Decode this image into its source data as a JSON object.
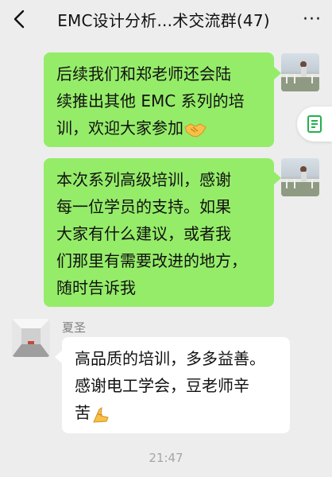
{
  "header": {
    "title": "EMC设计分析...术交流群(47)",
    "back_icon": "chevron-left-icon",
    "more_icon": "more-dots-icon",
    "more_label": "···"
  },
  "colors": {
    "background": "#ededed",
    "my_bubble": "#95ec69",
    "other_bubble": "#ffffff",
    "side_tab_icon": "#23b14d"
  },
  "messages": [
    {
      "sender": "me",
      "lines": [
        "后续我们和郑老师还会陆",
        "续推出其他 EMC 系列的培",
        "训，欢迎大家参加"
      ],
      "trailing_icon": "handshake-emoji"
    },
    {
      "sender": "me",
      "lines": [
        "本次系列高级培训，感谢",
        "每一位学员的支持。如果",
        "大家有什么建议，或者我",
        "们那里有需要改进的地方，",
        "随时告诉我"
      ]
    },
    {
      "sender": "other",
      "sender_name": "夏圣",
      "lines": [
        "高品质的培训，多多益善。",
        "感谢电工学会，豆老师辛",
        "苦"
      ],
      "trailing_icon": "praying-hands-emoji"
    }
  ],
  "timestamp": "21:47",
  "side_tab": {
    "icon": "document-icon"
  }
}
